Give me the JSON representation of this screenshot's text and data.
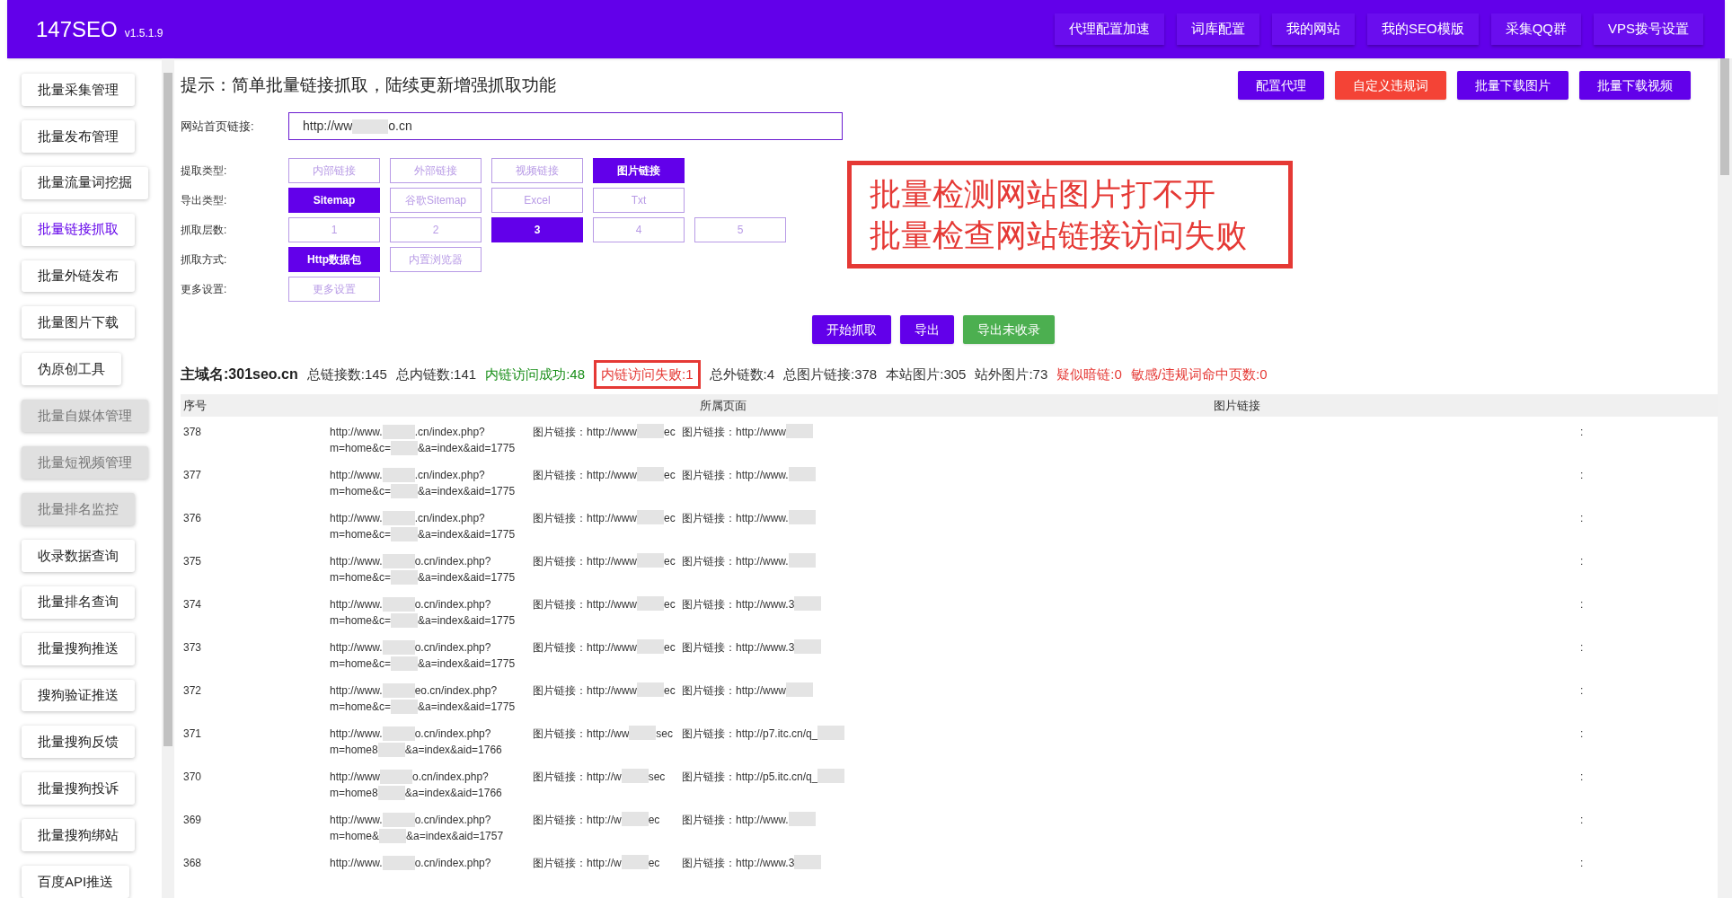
{
  "header": {
    "logo": "147SEO",
    "version": "v1.5.1.9",
    "nav": [
      "代理配置加速",
      "词库配置",
      "我的网站",
      "我的SEO模版",
      "采集QQ群",
      "VPS拨号设置"
    ]
  },
  "sidebar": {
    "items": [
      {
        "label": "批量采集管理",
        "selected": false,
        "disabled": false
      },
      {
        "label": "批量发布管理",
        "selected": false,
        "disabled": false
      },
      {
        "label": "批量流量词挖掘",
        "selected": false,
        "disabled": false
      },
      {
        "label": "批量链接抓取",
        "selected": true,
        "disabled": false
      },
      {
        "label": "批量外链发布",
        "selected": false,
        "disabled": false
      },
      {
        "label": "批量图片下载",
        "selected": false,
        "disabled": false
      },
      {
        "label": "伪原创工具",
        "selected": false,
        "disabled": false
      },
      {
        "label": "批量自媒体管理",
        "selected": false,
        "disabled": true
      },
      {
        "label": "批量短视频管理",
        "selected": false,
        "disabled": true
      },
      {
        "label": "批量排名监控",
        "selected": false,
        "disabled": true
      },
      {
        "label": "收录数据查询",
        "selected": false,
        "disabled": false
      },
      {
        "label": "批量排名查询",
        "selected": false,
        "disabled": false
      },
      {
        "label": "批量搜狗推送",
        "selected": false,
        "disabled": false
      },
      {
        "label": "搜狗验证推送",
        "selected": false,
        "disabled": false
      },
      {
        "label": "批量搜狗反馈",
        "selected": false,
        "disabled": false
      },
      {
        "label": "批量搜狗投诉",
        "selected": false,
        "disabled": false
      },
      {
        "label": "批量搜狗绑站",
        "selected": false,
        "disabled": false
      },
      {
        "label": "百度API推送",
        "selected": false,
        "disabled": false
      }
    ]
  },
  "hint": "提示：简单批量链接抓取，陆续更新增强抓取功能",
  "top_buttons": [
    {
      "label": "配置代理",
      "kind": "primary"
    },
    {
      "label": "自定义违规词",
      "kind": "danger"
    },
    {
      "label": "批量下载图片",
      "kind": "primary"
    },
    {
      "label": "批量下载视频",
      "kind": "primary"
    }
  ],
  "url_field": {
    "label": "网站首页链接:",
    "value_start": "http://ww",
    "value_end": "o.cn"
  },
  "option_groups": [
    {
      "label": "提取类型:",
      "options": [
        {
          "label": "内部链接",
          "selected": false
        },
        {
          "label": "外部链接",
          "selected": false
        },
        {
          "label": "视频链接",
          "selected": false
        },
        {
          "label": "图片链接",
          "selected": true
        }
      ]
    },
    {
      "label": "导出类型:",
      "options": [
        {
          "label": "Sitemap",
          "selected": true
        },
        {
          "label": "谷歌Sitemap",
          "selected": false
        },
        {
          "label": "Excel",
          "selected": false
        },
        {
          "label": "Txt",
          "selected": false
        }
      ]
    },
    {
      "label": "抓取层数:",
      "options": [
        {
          "label": "1",
          "selected": false
        },
        {
          "label": "2",
          "selected": false
        },
        {
          "label": "3",
          "selected": true
        },
        {
          "label": "4",
          "selected": false
        },
        {
          "label": "5",
          "selected": false
        }
      ]
    },
    {
      "label": "抓取方式:",
      "options": [
        {
          "label": "Http数据包",
          "selected": true
        },
        {
          "label": "内置浏览器",
          "selected": false
        }
      ]
    },
    {
      "label": "更多设置:",
      "options": [
        {
          "label": "更多设置",
          "selected": false
        }
      ]
    }
  ],
  "annotation": {
    "lines": [
      "批量检测网站图片打不开",
      "批量检查网站链接访问失败"
    ]
  },
  "action_buttons": [
    {
      "label": "开始抓取",
      "kind": "primary"
    },
    {
      "label": "导出",
      "kind": "primary"
    },
    {
      "label": "导出未收录",
      "kind": "success"
    }
  ],
  "stats": [
    {
      "text": "主域名:301seo.cn",
      "kind": "domain",
      "color": "#222222",
      "highlighted": false
    },
    {
      "text": "总链接数:145",
      "kind": "count",
      "color": "#333333",
      "highlighted": false
    },
    {
      "text": "总内链数:141",
      "kind": "count",
      "color": "#333333",
      "highlighted": false
    },
    {
      "text": "内链访问成功:48",
      "kind": "count",
      "color": "#1a8f1a",
      "highlighted": false
    },
    {
      "text": "内链访问失败:1",
      "kind": "count",
      "color": "#e53935",
      "highlighted": true
    },
    {
      "text": "总外链数:4",
      "kind": "count",
      "color": "#333333",
      "highlighted": false
    },
    {
      "text": "总图片链接:378",
      "kind": "count",
      "color": "#333333",
      "highlighted": false
    },
    {
      "text": "本站图片:305",
      "kind": "count",
      "color": "#333333",
      "highlighted": false
    },
    {
      "text": "站外图片:73",
      "kind": "count",
      "color": "#333333",
      "highlighted": false
    },
    {
      "text": "疑似暗链:0",
      "kind": "count",
      "color": "#e53935",
      "highlighted": false
    },
    {
      "text": "敏感/违规词命中页数:0",
      "kind": "count",
      "color": "#e53935",
      "highlighted": false
    }
  ],
  "table": {
    "columns": [
      "序号",
      "所属页面",
      "图片链接"
    ],
    "rows": [
      {
        "id": "378",
        "page": [
          "http://www.",
          ".cn/index.php?",
          "m=home&c=",
          "&a=index&aid=1775"
        ],
        "link_1": [
          "图片链接：http://www",
          "ec"
        ],
        "link_2": "图片链接：http://www",
        "column_4": ":"
      },
      {
        "id": "377",
        "page": [
          "http://www.",
          ".cn/index.php?",
          "m=home&c=",
          "&a=index&aid=1775"
        ],
        "link_1": [
          "图片链接：http://www",
          "ec"
        ],
        "link_2": "图片链接：http://www.",
        "column_4": ":"
      },
      {
        "id": "376",
        "page": [
          "http://www.",
          ".cn/index.php?",
          "m=home&c=",
          "&a=index&aid=1775"
        ],
        "link_1": [
          "图片链接：http://www",
          "ec"
        ],
        "link_2": "图片链接：http://www.",
        "column_4": ":"
      },
      {
        "id": "375",
        "page": [
          "http://www.",
          "o.cn/index.php?",
          "m=home&c=",
          "&a=index&aid=1775"
        ],
        "link_1": [
          "图片链接：http://www",
          "ec"
        ],
        "link_2": "图片链接：http://www.",
        "column_4": ":"
      },
      {
        "id": "374",
        "page": [
          "http://www.",
          "o.cn/index.php?",
          "m=home&c=",
          "&a=index&aid=1775"
        ],
        "link_1": [
          "图片链接：http://www",
          "ec"
        ],
        "link_2": "图片链接：http://www.3",
        "column_4": ":"
      },
      {
        "id": "373",
        "page": [
          "http://www.",
          "o.cn/index.php?",
          "m=home&c=",
          "&a=index&aid=1775"
        ],
        "link_1": [
          "图片链接：http://www",
          "ec"
        ],
        "link_2": "图片链接：http://www.3",
        "column_4": ":"
      },
      {
        "id": "372",
        "page": [
          "http://www.",
          "eo.cn/index.php?",
          "m=home&c=",
          "&a=index&aid=1775"
        ],
        "link_1": [
          "图片链接：http://www",
          "ec"
        ],
        "link_2": "图片链接：http://www",
        "column_4": ":"
      },
      {
        "id": "371",
        "page": [
          "http://www.",
          "o.cn/index.php?",
          "m=home8",
          "&a=index&aid=1766"
        ],
        "link_1": [
          "图片链接：http://ww",
          "sec"
        ],
        "link_2": "图片链接：http://p7.itc.cn/q_",
        "column_4": ":"
      },
      {
        "id": "370",
        "page": [
          "http://www",
          "o.cn/index.php?",
          "m=home8",
          "&a=index&aid=1766"
        ],
        "link_1": [
          "图片链接：http://w",
          "sec"
        ],
        "link_2": "图片链接：http://p5.itc.cn/q_",
        "column_4": ":"
      },
      {
        "id": "369",
        "page": [
          "http://www.",
          "o.cn/index.php?",
          "m=home&",
          "&a=index&aid=1757"
        ],
        "link_1": [
          "图片链接：http://w",
          "ec"
        ],
        "link_2": "图片链接：http://www.",
        "column_4": ":"
      },
      {
        "id": "368",
        "page": [
          "http://www.",
          "o.cn/index.php?"
        ],
        "link_1": [
          "图片链接：http://w",
          "ec"
        ],
        "link_2": "图片链接：http://www.3",
        "column_4": ":"
      }
    ]
  }
}
